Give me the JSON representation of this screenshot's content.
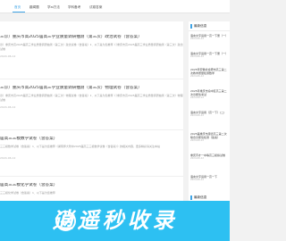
{
  "nav": {
    "items": [
      "首页",
      "趣闻题",
      "学ai方法",
      "学科备考",
      "试卷答案"
    ]
  },
  "articles": [
    {
      "title": "三诊）重庆市高2025届高三学业质量调研抽测（第三次）政治试卷（含答案）",
      "summary": "诊）重庆市高2025届高三学业质量调研抽测（第三次）政治试卷（含答案）1．以下是为您推荐《（重庆市高2025届高三学业质量调研抽测（第三次）政治试卷",
      "meta": "2024-06-12"
    },
    {
      "title": "三诊）重庆市高2025届高三学业质量调研抽测（第三次）物理试卷（含答案）",
      "summary": "诊）重庆市高2025届高三学业质量调研抽测（第三次）物理试卷（含答案）1．以下是为您推荐《（重庆市高2025届高三学业质量调研抽测（第三次）物理试卷",
      "meta": "2024-06-12"
    },
    {
      "title": "届高三三模数学试卷（含答案）",
      "summary": "三三模数学试卷（含答案）1．以下是为您推荐《湖南师大附中2025届高三三模数学试卷（含答案）》的相关内容，更多精彩请关注本站",
      "meta": "2024-06-12"
    },
    {
      "title": "届高三三模化学试卷（含答案）",
      "summary": "三三模化学试卷（含答案）1．以下是为您推荐",
      "meta": "2024-06-12"
    }
  ],
  "sidebar": {
    "header": "最新信息",
    "items": [
      {
        "title": "语言文字运用一高一下册（一）",
        "date": "2024-06-12"
      },
      {
        "title": "语言文字运用一高一下册（一）",
        "date": "2024-06-12"
      },
      {
        "title": "2025年安徽省合肥市高三第二次教学质量检测数学",
        "date": "2024-06-12"
      },
      {
        "title": "2025年重庆市渝中区高三第二次诊断性考试",
        "date": "2024-06-12"
      },
      {
        "title": "语言文字运用（高一下）(二)",
        "date": "2024-06-12"
      },
      {
        "title": "2025届重庆市康德高三第二次联合诊断性检测（答案）",
        "date": "2024-06-12"
      },
      {
        "title": "重庆育才一中等高三模拟试卷",
        "date": "2024-06-12"
      },
      {
        "title": "语言文字运用一高一下",
        "date": "2024-06-12"
      }
    ]
  },
  "sidebar2": {
    "header": "最新信息"
  },
  "banner": {
    "text": "逍遥秒收录"
  },
  "colors": {
    "accent": "#3fa4e6",
    "banner": "#2dc0f2"
  }
}
